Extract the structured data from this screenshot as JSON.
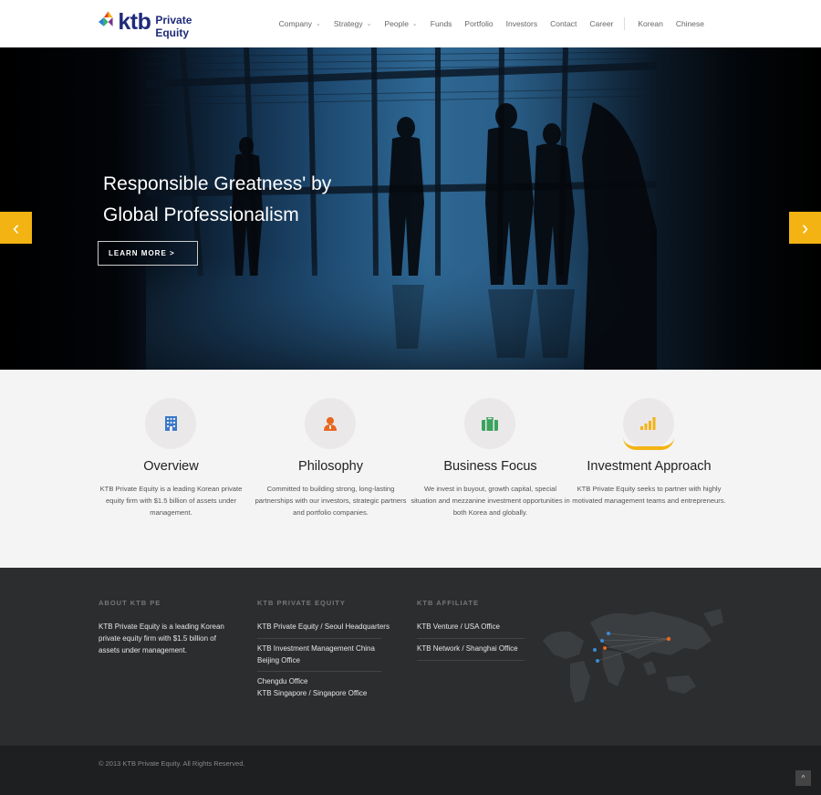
{
  "header": {
    "logo_text": "ktb",
    "logo_sub": "Private Equity",
    "nav": [
      {
        "label": "Company",
        "has_dropdown": true
      },
      {
        "label": "Strategy",
        "has_dropdown": true
      },
      {
        "label": "People",
        "has_dropdown": true
      },
      {
        "label": "Funds",
        "has_dropdown": false
      },
      {
        "label": "Portfolio",
        "has_dropdown": false
      },
      {
        "label": "Investors",
        "has_dropdown": false
      },
      {
        "label": "Contact",
        "has_dropdown": false
      },
      {
        "label": "Career",
        "has_dropdown": false
      }
    ],
    "languages": [
      "Korean",
      "Chinese"
    ]
  },
  "hero": {
    "title_line1": "Responsible Greatness' by",
    "title_line2": "Global Professionalism",
    "cta": "LEARN MORE >",
    "prev_icon": "‹",
    "next_icon": "›"
  },
  "features": [
    {
      "title": "Overview",
      "icon": "building-icon",
      "text": "KTB Private Equity is a leading Korean private equity firm with $1.5 billion of assets under management."
    },
    {
      "title": "Philosophy",
      "icon": "person-icon",
      "text": "Committed to building strong, long-lasting partnerships with our investors, strategic partners and portfolio companies."
    },
    {
      "title": "Business Focus",
      "icon": "briefcase-icon",
      "text": "We invest in buyout, growth capital, special situation and mezzanine investment opportunities in both Korea and globally."
    },
    {
      "title": "Investment Approach",
      "icon": "bar-chart-icon",
      "text": "KTB Private Equity seeks to partner with highly motivated management teams and entrepreneurs."
    }
  ],
  "footer": {
    "about_heading": "ABOUT KTB PE",
    "about_text": "KTB Private Equity is a leading Korean private equity firm with $1.5 billion of assets under management.",
    "pe_heading": "KTB PRIVATE EQUITY",
    "pe_links": [
      "KTB Private Equity / Seoul Headquarters",
      "KTB Investment Management China Beijing Office",
      "Chengdu Office",
      "KTB Singapore / Singapore Office"
    ],
    "affiliate_heading": "KTB AFFILIATE",
    "affiliate_links": [
      "KTB Venture / USA Office",
      "KTB Network / Shanghai Office"
    ],
    "copyright": "© 2013  KTB Private Equity. All Rights Reserved.",
    "totop_icon": "^"
  },
  "colors": {
    "accent": "#f3b312",
    "brand_navy": "#1f2a7a",
    "footer_bg": "#2b2d2f",
    "bottom_bg": "#1e1f20"
  }
}
